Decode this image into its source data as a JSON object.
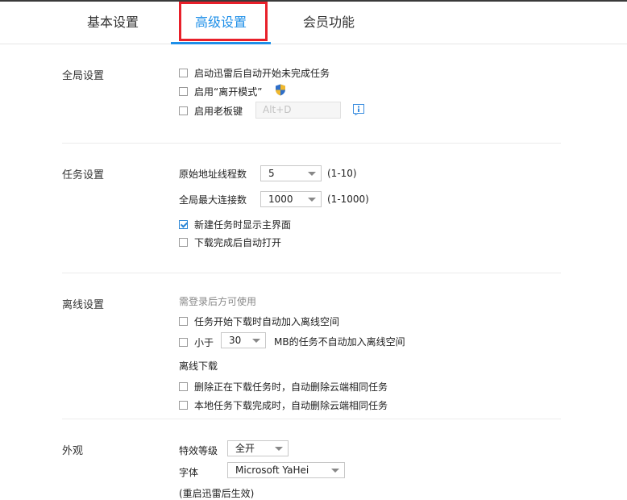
{
  "tabs": [
    "基本设置",
    "高级设置",
    "会员功能"
  ],
  "active_tab": "高级设置",
  "accent_color": "#1e8fe8",
  "highlight_color": "#e8202a",
  "global": {
    "title": "全局设置",
    "auto_start_label": "启动迅雷后自动开始未完成任务",
    "leave_mode_label": "启用“离开模式”",
    "boss_key_label": "启用老板键",
    "boss_key_value": "Alt+D",
    "boss_key_icon": "info-icon",
    "leave_mode_icon": "shield-icon"
  },
  "task": {
    "title": "任务设置",
    "threads_label": "原始地址线程数",
    "threads_value": "5",
    "threads_range": "(1-10)",
    "max_conn_label": "全局最大连接数",
    "max_conn_value": "1000",
    "max_conn_range": "(1-1000)",
    "show_main_label": "新建任务时显示主界面",
    "show_main_checked": true,
    "auto_open_label": "下载完成后自动打开"
  },
  "offline": {
    "title": "离线设置",
    "note": "需登录后方可使用",
    "auto_add_label": "任务开始下载时自动加入离线空间",
    "less_than_label": "小于",
    "size_value": "30",
    "size_suffix": "MB的任务不自动加入离线空间",
    "subtitle": "离线下载",
    "delete_downloading_label": "删除正在下载任务时，自动删除云端相同任务",
    "delete_local_label": "本地任务下载完成时，自动删除云端相同任务"
  },
  "appearance": {
    "title": "外观",
    "effects_label": "特效等级",
    "effects_value": "全开",
    "font_label": "字体",
    "font_value": "Microsoft YaHei",
    "restart_note": "(重启迅雷后生效)"
  }
}
